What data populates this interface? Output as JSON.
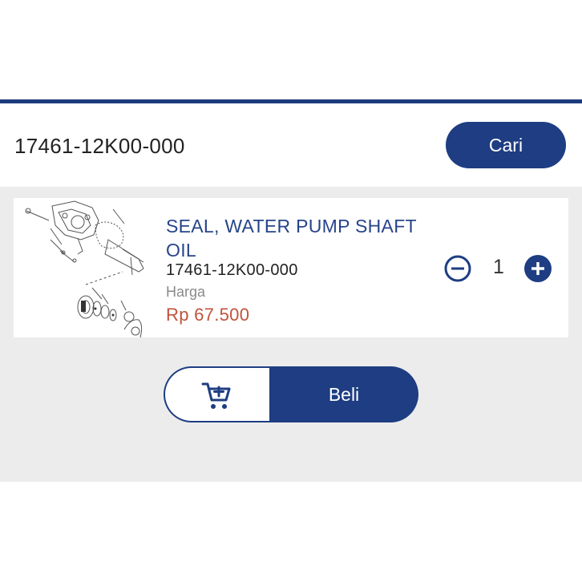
{
  "search": {
    "query": "17461-12K00-000",
    "button_label": "Cari"
  },
  "product": {
    "name": "SEAL, WATER PUMP SHAFT OIL",
    "code": "17461-12K00-000",
    "price_label": "Harga",
    "price": "Rp 67.500",
    "image_icon": "parts-diagram"
  },
  "quantity": {
    "value": "1"
  },
  "actions": {
    "cart_icon": "cart-icon",
    "buy_label": "Beli"
  },
  "colors": {
    "brand": "#1e3d82",
    "price": "#c1533a",
    "background": "#ececec"
  }
}
